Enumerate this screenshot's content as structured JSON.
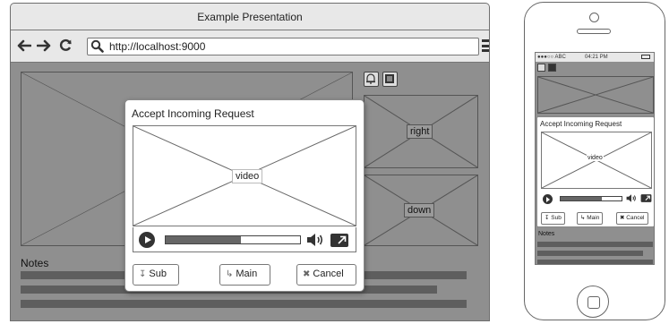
{
  "browser": {
    "title": "Example Presentation",
    "url": "http://localhost:9000",
    "icons": [
      "back-arrow-icon",
      "forward-arrow-icon",
      "reload-icon",
      "search-icon",
      "menu-icon"
    ],
    "panels": {
      "right_label": "right",
      "down_label": "down"
    },
    "notes_label": "Notes"
  },
  "dialog": {
    "title": "Accept Incoming Request",
    "video_label": "video",
    "progress": 0.56,
    "buttons": {
      "sub": "Sub",
      "main": "Main",
      "cancel": "Cancel"
    }
  },
  "phone": {
    "status": {
      "carrier": "●●●○○ ABC",
      "time": "04:21 PM"
    },
    "dialog": {
      "title": "Accept Incoming Request",
      "video_label": "video",
      "progress": 0.68,
      "buttons": {
        "sub": "Sub",
        "main": "Main",
        "cancel": "Cancel"
      }
    },
    "notes_label": "Notes"
  },
  "colors": {
    "canvas": "#8f8f8f",
    "chrome": "#e8e8e8",
    "note_line": "#5e5e5e"
  }
}
